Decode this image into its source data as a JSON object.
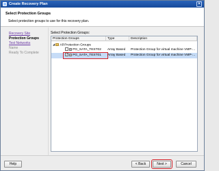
{
  "window": {
    "title": "Create Recovery Plan"
  },
  "header": {
    "title": "Select Protection Groups",
    "subtitle": "Select protection groups to use for this recovery plan."
  },
  "steps": [
    {
      "label": "Recovery Site",
      "state": "link"
    },
    {
      "label": "Protection Groups",
      "state": "current"
    },
    {
      "label": "Test Networks",
      "state": "link"
    },
    {
      "label": "Name",
      "state": "disabled"
    },
    {
      "label": "Ready To Complete",
      "state": "disabled"
    }
  ],
  "main": {
    "label": "Select Protection Groups:",
    "columns": [
      "Protection Groups",
      "Type",
      "Description"
    ],
    "tree_root": "All Protection Groups",
    "rows": [
      {
        "name": "PG_SATA_TEST02",
        "type": "Array Based",
        "description": "Protection Group for virtual machine VMP-...",
        "checked": false,
        "selected": false
      },
      {
        "name": "PG_SATA_TEST01",
        "type": "Array Based",
        "description": "Protection Group for virtual machine VMP-...",
        "checked": true,
        "selected": true
      }
    ]
  },
  "footer": {
    "help": "Help",
    "back": "< Back",
    "next": "Next >",
    "cancel": "Cancel"
  }
}
